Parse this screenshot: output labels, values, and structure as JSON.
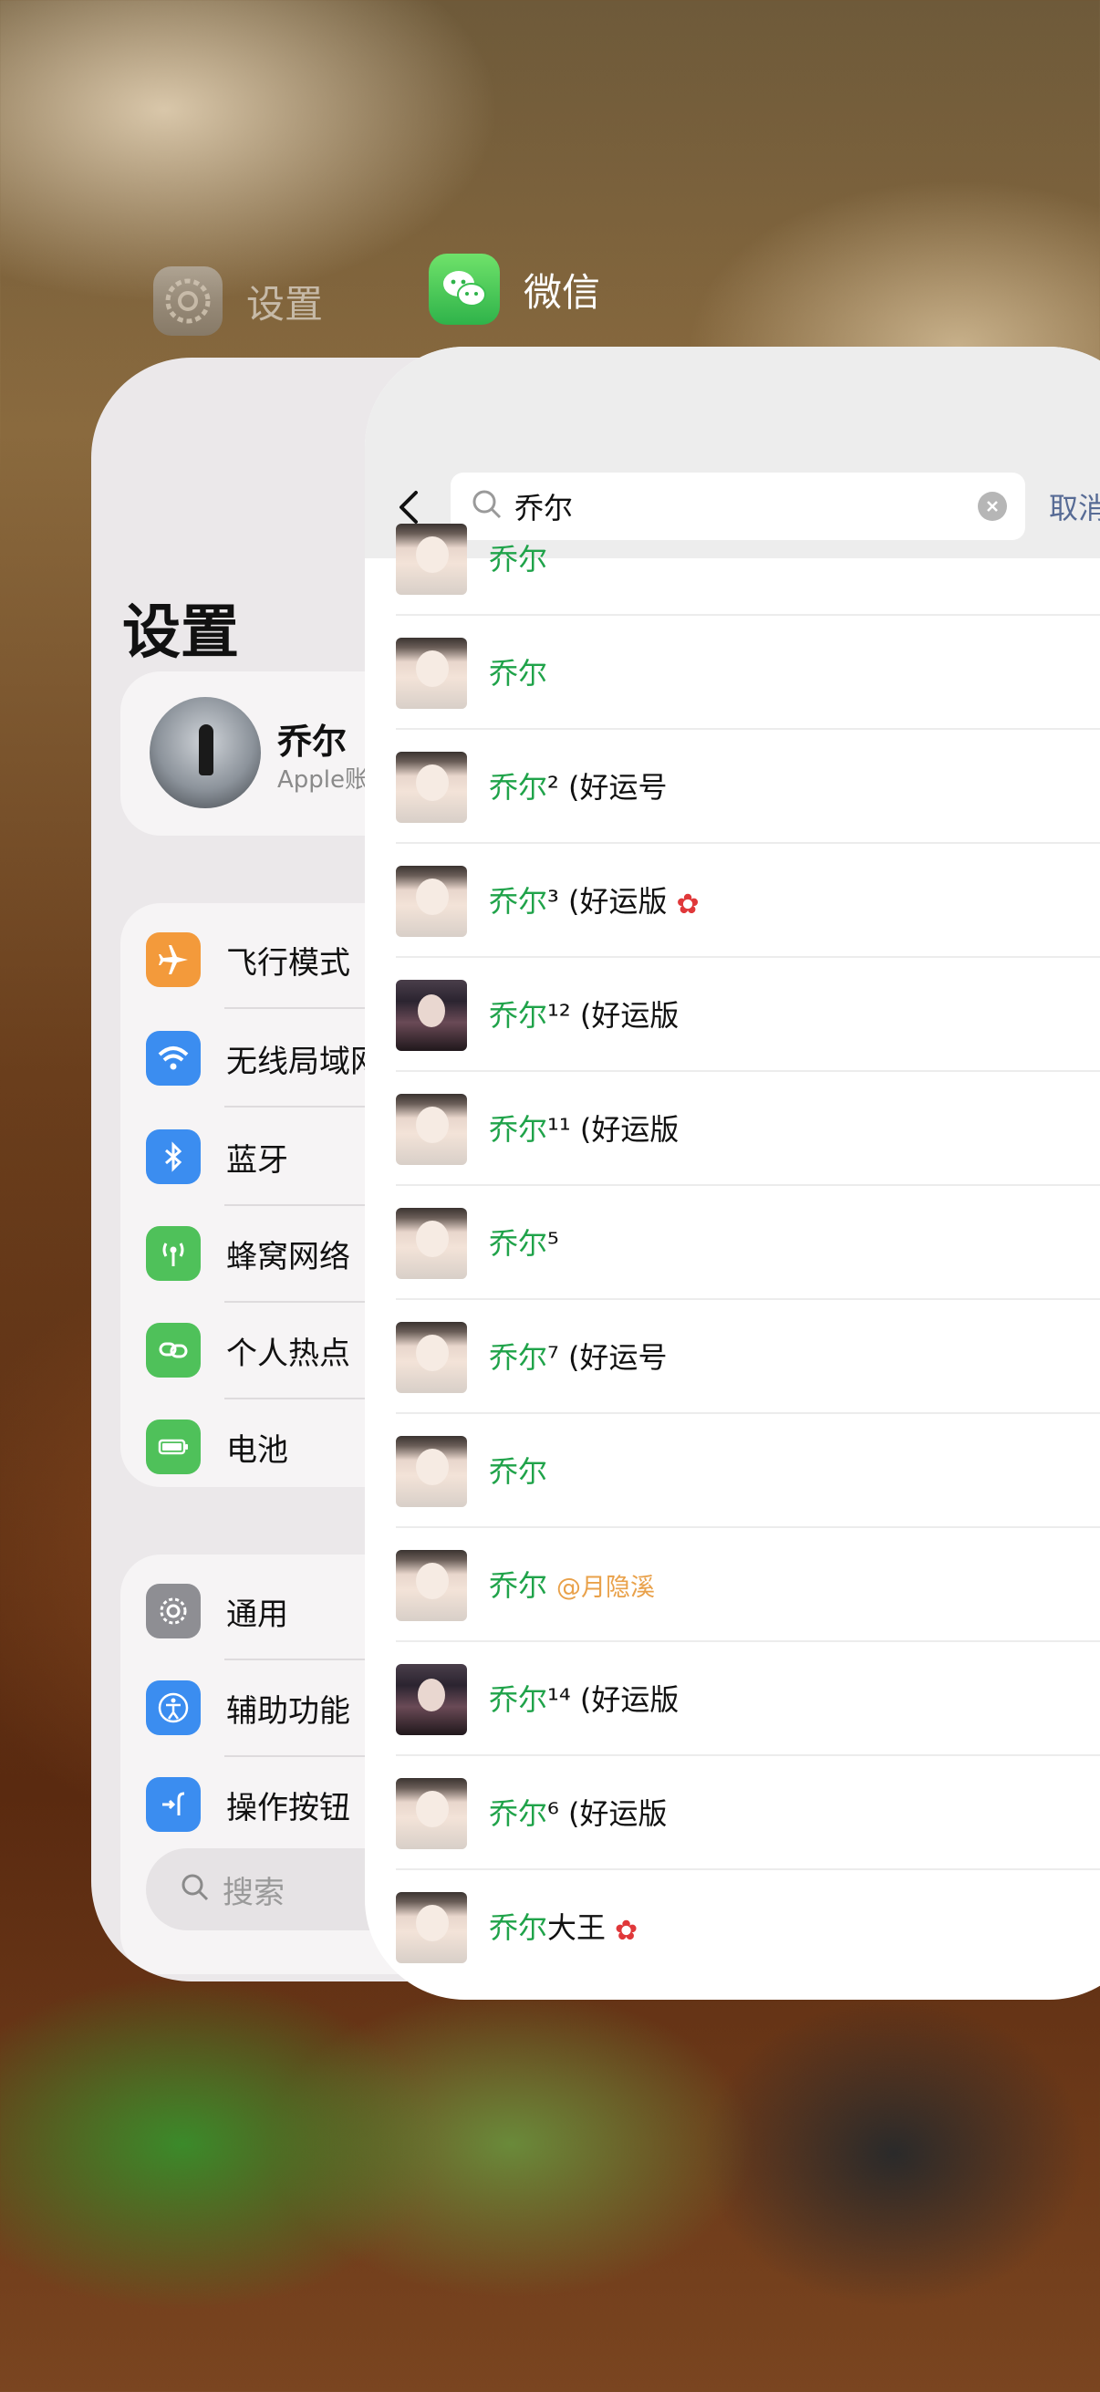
{
  "switcher": {
    "settings_app_name": "设置",
    "wechat_app_name": "微信"
  },
  "settings": {
    "title": "设置",
    "profile": {
      "name": "乔尔",
      "subtitle": "Apple账户、iCloud等"
    },
    "connectivity": [
      {
        "label": "飞行模式",
        "icon": "airplane-icon",
        "color": "#f39a3b"
      },
      {
        "label": "无线局域网",
        "icon": "wifi-icon",
        "color": "#3b8df0"
      },
      {
        "label": "蓝牙",
        "icon": "bluetooth-icon",
        "color": "#3b8df0"
      },
      {
        "label": "蜂窝网络",
        "icon": "cellular-icon",
        "color": "#4fc15a"
      },
      {
        "label": "个人热点",
        "icon": "hotspot-icon",
        "color": "#4fc15a"
      },
      {
        "label": "电池",
        "icon": "battery-icon",
        "color": "#4fc15a"
      }
    ],
    "general": [
      {
        "label": "通用",
        "icon": "gear-icon",
        "color": "#8e8e93"
      },
      {
        "label": "辅助功能",
        "icon": "accessibility-icon",
        "color": "#3b8df0"
      },
      {
        "label": "操作按钮",
        "icon": "action-button-icon",
        "color": "#3b8df0"
      }
    ],
    "search_placeholder": "搜索"
  },
  "wechat": {
    "search_query": "乔尔",
    "cancel_label": "取消",
    "results": [
      {
        "name": "乔尔",
        "suffix": "",
        "avatar": "blonde"
      },
      {
        "name": "乔尔",
        "suffix": "",
        "avatar": "blonde"
      },
      {
        "name": "乔尔",
        "suffix": "² (好运号",
        "avatar": "blonde"
      },
      {
        "name": "乔尔",
        "suffix": "³ (好运版",
        "avatar": "blonde",
        "flower": true
      },
      {
        "name": "乔尔",
        "suffix": "¹² (好运版",
        "avatar": "dark"
      },
      {
        "name": "乔尔",
        "suffix": "¹¹ (好运版",
        "avatar": "blonde"
      },
      {
        "name": "乔尔",
        "suffix": "⁵",
        "avatar": "blonde"
      },
      {
        "name": "乔尔",
        "suffix": "⁷ (好运号",
        "avatar": "blonde"
      },
      {
        "name": "乔尔",
        "suffix": "",
        "avatar": "blonde"
      },
      {
        "name": "乔尔",
        "suffix": "@月隐溪",
        "avatar": "blonde",
        "at": true
      },
      {
        "name": "乔尔",
        "suffix": "¹⁴ (好运版",
        "avatar": "dark"
      },
      {
        "name": "乔尔",
        "suffix": "⁶ (好运版",
        "avatar": "blonde"
      },
      {
        "name": "乔尔",
        "suffix": "大王",
        "avatar": "blonde",
        "flower": true
      }
    ]
  }
}
